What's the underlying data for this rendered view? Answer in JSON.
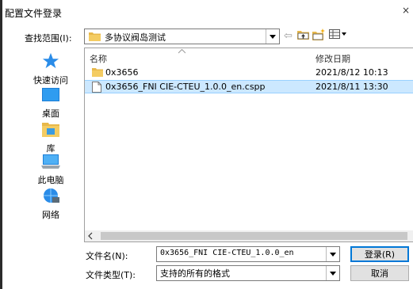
{
  "dialog": {
    "title": "配置文件登录",
    "close_glyph": "×"
  },
  "look_in": {
    "label": "查找范围(I):",
    "value": "多协议阀岛测试"
  },
  "toolbar": {
    "back_glyph": "⇦"
  },
  "places": [
    {
      "label": "快速访问",
      "icon": "star-icon"
    },
    {
      "label": "桌面",
      "icon": "desktop-icon"
    },
    {
      "label": "库",
      "icon": "library-icon"
    },
    {
      "label": "此电脑",
      "icon": "computer-icon"
    },
    {
      "label": "网络",
      "icon": "network-icon"
    }
  ],
  "file_list": {
    "columns": {
      "name": "名称",
      "date": "修改日期"
    },
    "rows": [
      {
        "name": "0x3656",
        "date": "2021/8/12 10:13",
        "type": "folder",
        "selected": false
      },
      {
        "name": "0x3656_FNI CIE-CTEU_1.0.0_en.cspp",
        "date": "2021/8/11 13:30",
        "type": "file",
        "selected": true
      }
    ]
  },
  "filename": {
    "label": "文件名(N):",
    "value": "0x3656_FNI CIE-CTEU_1.0.0_en"
  },
  "filetype": {
    "label": "文件类型(T):",
    "value": "支持的所有的格式"
  },
  "buttons": {
    "login": "登录(R)",
    "cancel": "取消"
  },
  "colors": {
    "selection": "#cce8ff",
    "folder": "#e8b84a",
    "accent": "#0078d7"
  }
}
